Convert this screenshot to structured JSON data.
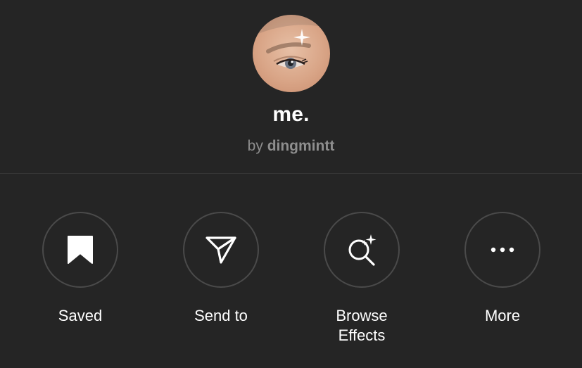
{
  "effect": {
    "name": "me.",
    "by_prefix": "by",
    "creator": "dingmintt"
  },
  "actions": [
    {
      "label": "Saved",
      "icon": "bookmark-filled-icon"
    },
    {
      "label": "Send to",
      "icon": "paper-plane-icon"
    },
    {
      "label": "Browse\nEffects",
      "icon": "sparkle-search-icon"
    },
    {
      "label": "More",
      "icon": "more-horizontal-icon"
    }
  ],
  "colors": {
    "background": "#252525",
    "divider": "#363636",
    "circle_border": "#4a4a4a",
    "text_primary": "#ffffff",
    "text_secondary": "#8e8e8e"
  }
}
